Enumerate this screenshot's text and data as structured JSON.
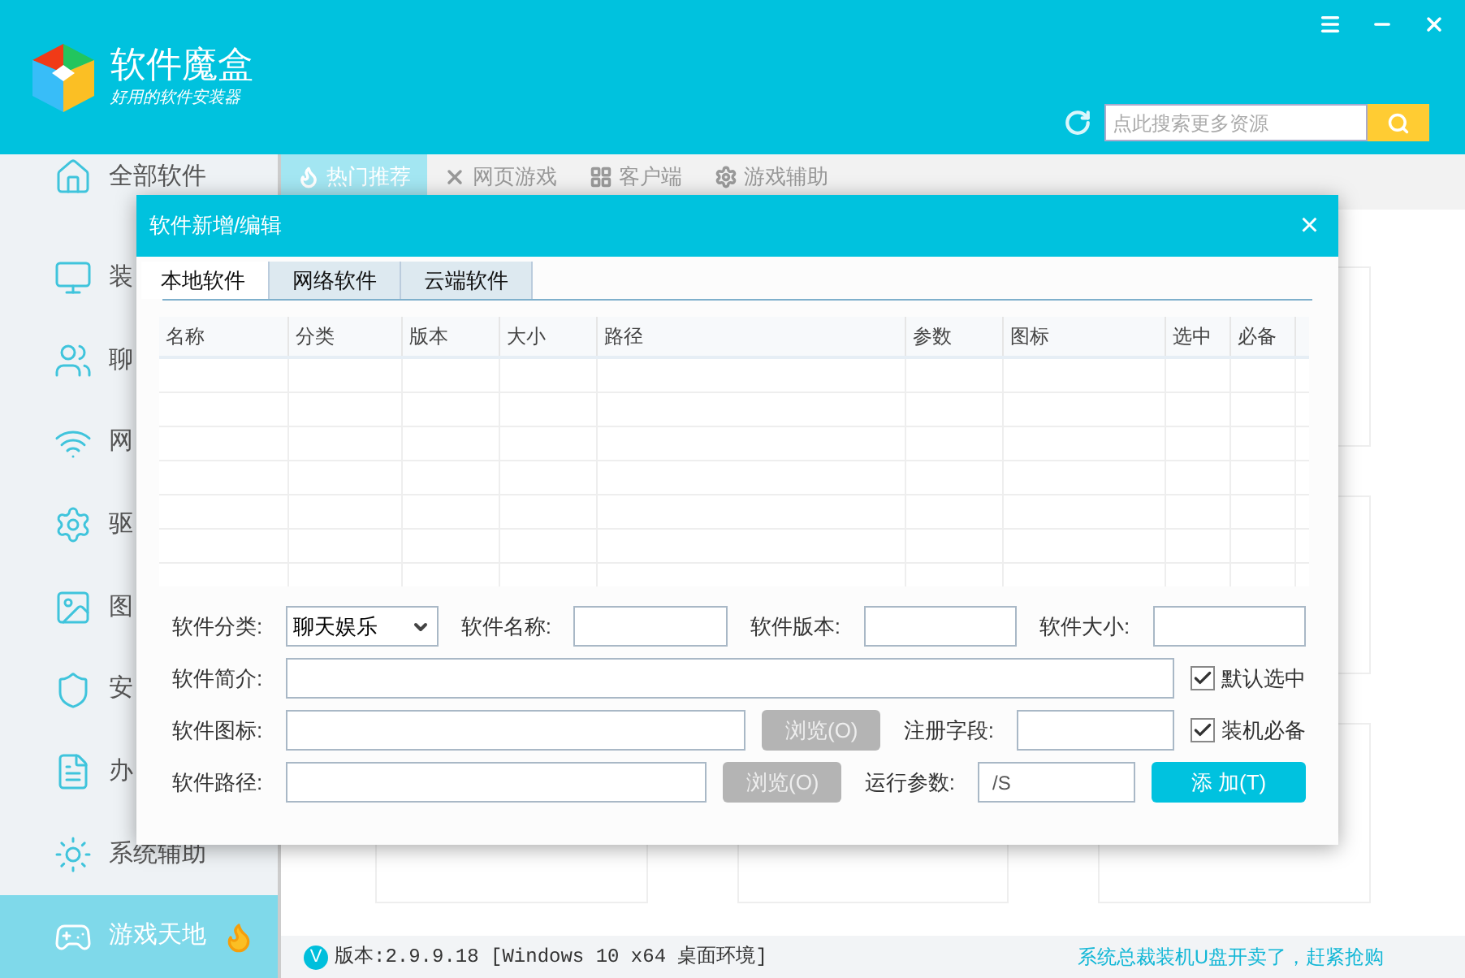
{
  "header": {
    "logo_title": "软件魔盒",
    "logo_subtitle": "好用的软件安装器",
    "search": {
      "placeholder": "点此搜索更多资源"
    }
  },
  "sidebar": {
    "items": [
      {
        "label": "全部软件",
        "selected": false
      },
      {
        "label": "装",
        "selected": false
      },
      {
        "label": "聊",
        "selected": false
      },
      {
        "label": "网",
        "selected": false
      },
      {
        "label": "驱",
        "selected": false
      },
      {
        "label": "图",
        "selected": false
      },
      {
        "label": "安",
        "selected": false
      },
      {
        "label": "办",
        "selected": false
      },
      {
        "label": "系统辅助",
        "selected": false
      },
      {
        "label": "游戏天地",
        "selected": true
      }
    ]
  },
  "tabs": [
    {
      "label": "热门推荐",
      "selected": true
    },
    {
      "label": "网页游戏",
      "selected": false
    },
    {
      "label": "客户端",
      "selected": false
    },
    {
      "label": "游戏辅助",
      "selected": false
    }
  ],
  "dialog": {
    "title": "软件新增/编辑",
    "close": "×",
    "tabs": [
      {
        "label": "本地软件",
        "selected": true
      },
      {
        "label": "网络软件",
        "selected": false
      },
      {
        "label": "云端软件",
        "selected": false
      }
    ],
    "table": {
      "columns": [
        "名称",
        "分类",
        "版本",
        "大小",
        "路径",
        "参数",
        "图标",
        "选中",
        "必备"
      ]
    },
    "form": [
      [
        {
          "kind": "label",
          "text": "软件分类:"
        },
        {
          "kind": "select",
          "value": "聊天娱乐"
        },
        {
          "kind": "label",
          "text": "软件名称:"
        },
        {
          "kind": "input"
        },
        {
          "kind": "label",
          "text": "软件版本:"
        },
        {
          "kind": "input"
        },
        {
          "kind": "label",
          "text": "软件大小:"
        },
        {
          "kind": "input"
        }
      ],
      [
        {
          "kind": "label",
          "text": "软件简介:"
        },
        {
          "kind": "input",
          "wide": true
        },
        {
          "kind": "checkbox",
          "text": "默认选中",
          "checked": true
        }
      ],
      [
        {
          "kind": "label",
          "text": "软件图标:"
        },
        {
          "kind": "input",
          "wide": true
        },
        {
          "kind": "button",
          "text": "浏览(O)",
          "disabled": true
        },
        {
          "kind": "label",
          "text": "注册字段:"
        },
        {
          "kind": "input"
        },
        {
          "kind": "checkbox",
          "text": "装机必备",
          "checked": true
        }
      ],
      [
        {
          "kind": "label",
          "text": "软件路径:"
        },
        {
          "kind": "input",
          "wide": true
        },
        {
          "kind": "button",
          "text": "浏览(O)",
          "disabled": true
        },
        {
          "kind": "label",
          "text": "运行参数:"
        },
        {
          "kind": "input",
          "value": "/S"
        },
        {
          "kind": "primary",
          "text": "添 加(T)"
        }
      ]
    ]
  },
  "status_bar": {
    "badge": "V",
    "version": "版本:2.9.9.18 [Windows 10 x64 桌面环境]",
    "link": "系统总裁装机U盘开卖了，赶紧抢购"
  }
}
